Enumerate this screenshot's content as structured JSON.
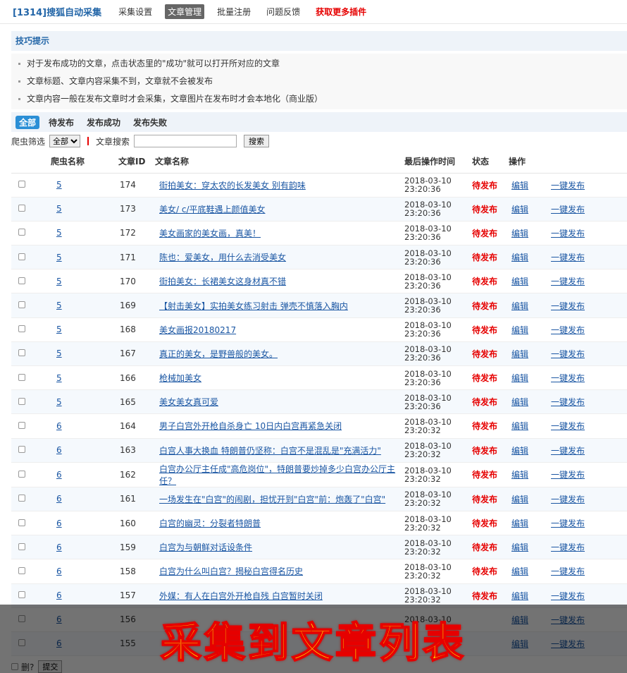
{
  "nav": {
    "brand": "[1314]搜狐自动采集",
    "items": [
      {
        "label": "采集设置",
        "active": false,
        "red": false
      },
      {
        "label": "文章管理",
        "active": true,
        "red": false
      },
      {
        "label": "批量注册",
        "active": false,
        "red": false
      },
      {
        "label": "问题反馈",
        "active": false,
        "red": false
      },
      {
        "label": "获取更多插件",
        "active": false,
        "red": true
      }
    ]
  },
  "tips": {
    "title": "技巧提示",
    "items": [
      "对于发布成功的文章，点击状态里的\"成功\"就可以打开所对应的文章",
      "文章标题、文章内容采集不到，文章就不会被发布",
      "文章内容一般在发布文章时才会采集，文章图片在发布时才会本地化（商业版）"
    ]
  },
  "tabs": [
    {
      "label": "全部",
      "active": true
    },
    {
      "label": "待发布",
      "active": false
    },
    {
      "label": "发布成功",
      "active": false
    },
    {
      "label": "发布失败",
      "active": false
    }
  ],
  "filter": {
    "label": "爬虫筛选",
    "select_value": "全部",
    "search_label": "文章搜索",
    "search_value": "",
    "search_button": "搜索"
  },
  "table": {
    "headers": [
      "",
      "爬虫名称",
      "文章ID",
      "文章名称",
      "最后操作时间",
      "状态",
      "操作",
      ""
    ],
    "rows": [
      {
        "crawler": "5",
        "id": "174",
        "title": "街拍美女：穿太农的长发美女 别有韵味",
        "date": "2018-03-10",
        "time": "23:20:36",
        "status": "待发布",
        "edit": "编辑",
        "publish": "一键发布"
      },
      {
        "crawler": "5",
        "id": "173",
        "title": "美女/ c/平底鞋遇上颜值美女",
        "date": "2018-03-10",
        "time": "23:20:36",
        "status": "待发布",
        "edit": "编辑",
        "publish": "一键发布"
      },
      {
        "crawler": "5",
        "id": "172",
        "title": "美女画家的美女画，真美！",
        "date": "2018-03-10",
        "time": "23:20:36",
        "status": "待发布",
        "edit": "编辑",
        "publish": "一键发布"
      },
      {
        "crawler": "5",
        "id": "171",
        "title": "陈也：爱美女，用什么去消受美女",
        "date": "2018-03-10",
        "time": "23:20:36",
        "status": "待发布",
        "edit": "编辑",
        "publish": "一键发布"
      },
      {
        "crawler": "5",
        "id": "170",
        "title": "街拍美女：长裙美女这身材真不错",
        "date": "2018-03-10",
        "time": "23:20:36",
        "status": "待发布",
        "edit": "编辑",
        "publish": "一键发布"
      },
      {
        "crawler": "5",
        "id": "169",
        "title": "【射击美女】实拍美女练习射击 弹壳不慎落入胸内",
        "date": "2018-03-10",
        "time": "23:20:36",
        "status": "待发布",
        "edit": "编辑",
        "publish": "一键发布"
      },
      {
        "crawler": "5",
        "id": "168",
        "title": "美女画报20180217",
        "date": "2018-03-10",
        "time": "23:20:36",
        "status": "待发布",
        "edit": "编辑",
        "publish": "一键发布"
      },
      {
        "crawler": "5",
        "id": "167",
        "title": "真正的美女，是野兽般的美女。",
        "date": "2018-03-10",
        "time": "23:20:36",
        "status": "待发布",
        "edit": "编辑",
        "publish": "一键发布"
      },
      {
        "crawler": "5",
        "id": "166",
        "title": "枪械加美女",
        "date": "2018-03-10",
        "time": "23:20:36",
        "status": "待发布",
        "edit": "编辑",
        "publish": "一键发布"
      },
      {
        "crawler": "5",
        "id": "165",
        "title": "美女美女真可爱",
        "date": "2018-03-10",
        "time": "23:20:36",
        "status": "待发布",
        "edit": "编辑",
        "publish": "一键发布"
      },
      {
        "crawler": "6",
        "id": "164",
        "title": "男子白宫外开枪自杀身亡 10日内白宫再紧急关闭",
        "date": "2018-03-10",
        "time": "23:20:32",
        "status": "待发布",
        "edit": "编辑",
        "publish": "一键发布"
      },
      {
        "crawler": "6",
        "id": "163",
        "title": "白宫人事大换血 特朗普仍坚称：白宫不是混乱是\"充满活力\"",
        "date": "2018-03-10",
        "time": "23:20:32",
        "status": "待发布",
        "edit": "编辑",
        "publish": "一键发布"
      },
      {
        "crawler": "6",
        "id": "162",
        "title": "白宫办公厅主任成\"高危岗位\"，特朗普要炒掉多少白宫办公厅主任？",
        "date": "2018-03-10",
        "time": "23:20:32",
        "status": "待发布",
        "edit": "编辑",
        "publish": "一键发布"
      },
      {
        "crawler": "6",
        "id": "161",
        "title": "一场发生在\"白宫\"的闹剧，担忧开到\"白宫\"前：炮轰了\"白宫\"",
        "date": "2018-03-10",
        "time": "23:20:32",
        "status": "待发布",
        "edit": "编辑",
        "publish": "一键发布"
      },
      {
        "crawler": "6",
        "id": "160",
        "title": "白宫的幽灵：分裂者特朗普",
        "date": "2018-03-10",
        "time": "23:20:32",
        "status": "待发布",
        "edit": "编辑",
        "publish": "一键发布"
      },
      {
        "crawler": "6",
        "id": "159",
        "title": "白宫为与朝鲜对话设条件",
        "date": "2018-03-10",
        "time": "23:20:32",
        "status": "待发布",
        "edit": "编辑",
        "publish": "一键发布"
      },
      {
        "crawler": "6",
        "id": "158",
        "title": "白宫为什么叫白宫？揭秘白宫得名历史",
        "date": "2018-03-10",
        "time": "23:20:32",
        "status": "待发布",
        "edit": "编辑",
        "publish": "一键发布"
      },
      {
        "crawler": "6",
        "id": "157",
        "title": "外媒：有人在白宫外开枪自残 白宫暂时关闭",
        "date": "2018-03-10",
        "time": "23:20:32",
        "status": "待发布",
        "edit": "编辑",
        "publish": "一键发布"
      },
      {
        "crawler": "6",
        "id": "156",
        "title": "",
        "date": "2018-03-10",
        "time": "",
        "status": "",
        "edit": "编辑",
        "publish": "一键发布"
      },
      {
        "crawler": "6",
        "id": "155",
        "title": "",
        "date": "",
        "time": "",
        "status": "",
        "edit": "编辑",
        "publish": "一键发布"
      }
    ]
  },
  "bottom": {
    "delete_label": "删?",
    "submit_label": "提交"
  },
  "banner": {
    "text": "采集到文章列表"
  }
}
